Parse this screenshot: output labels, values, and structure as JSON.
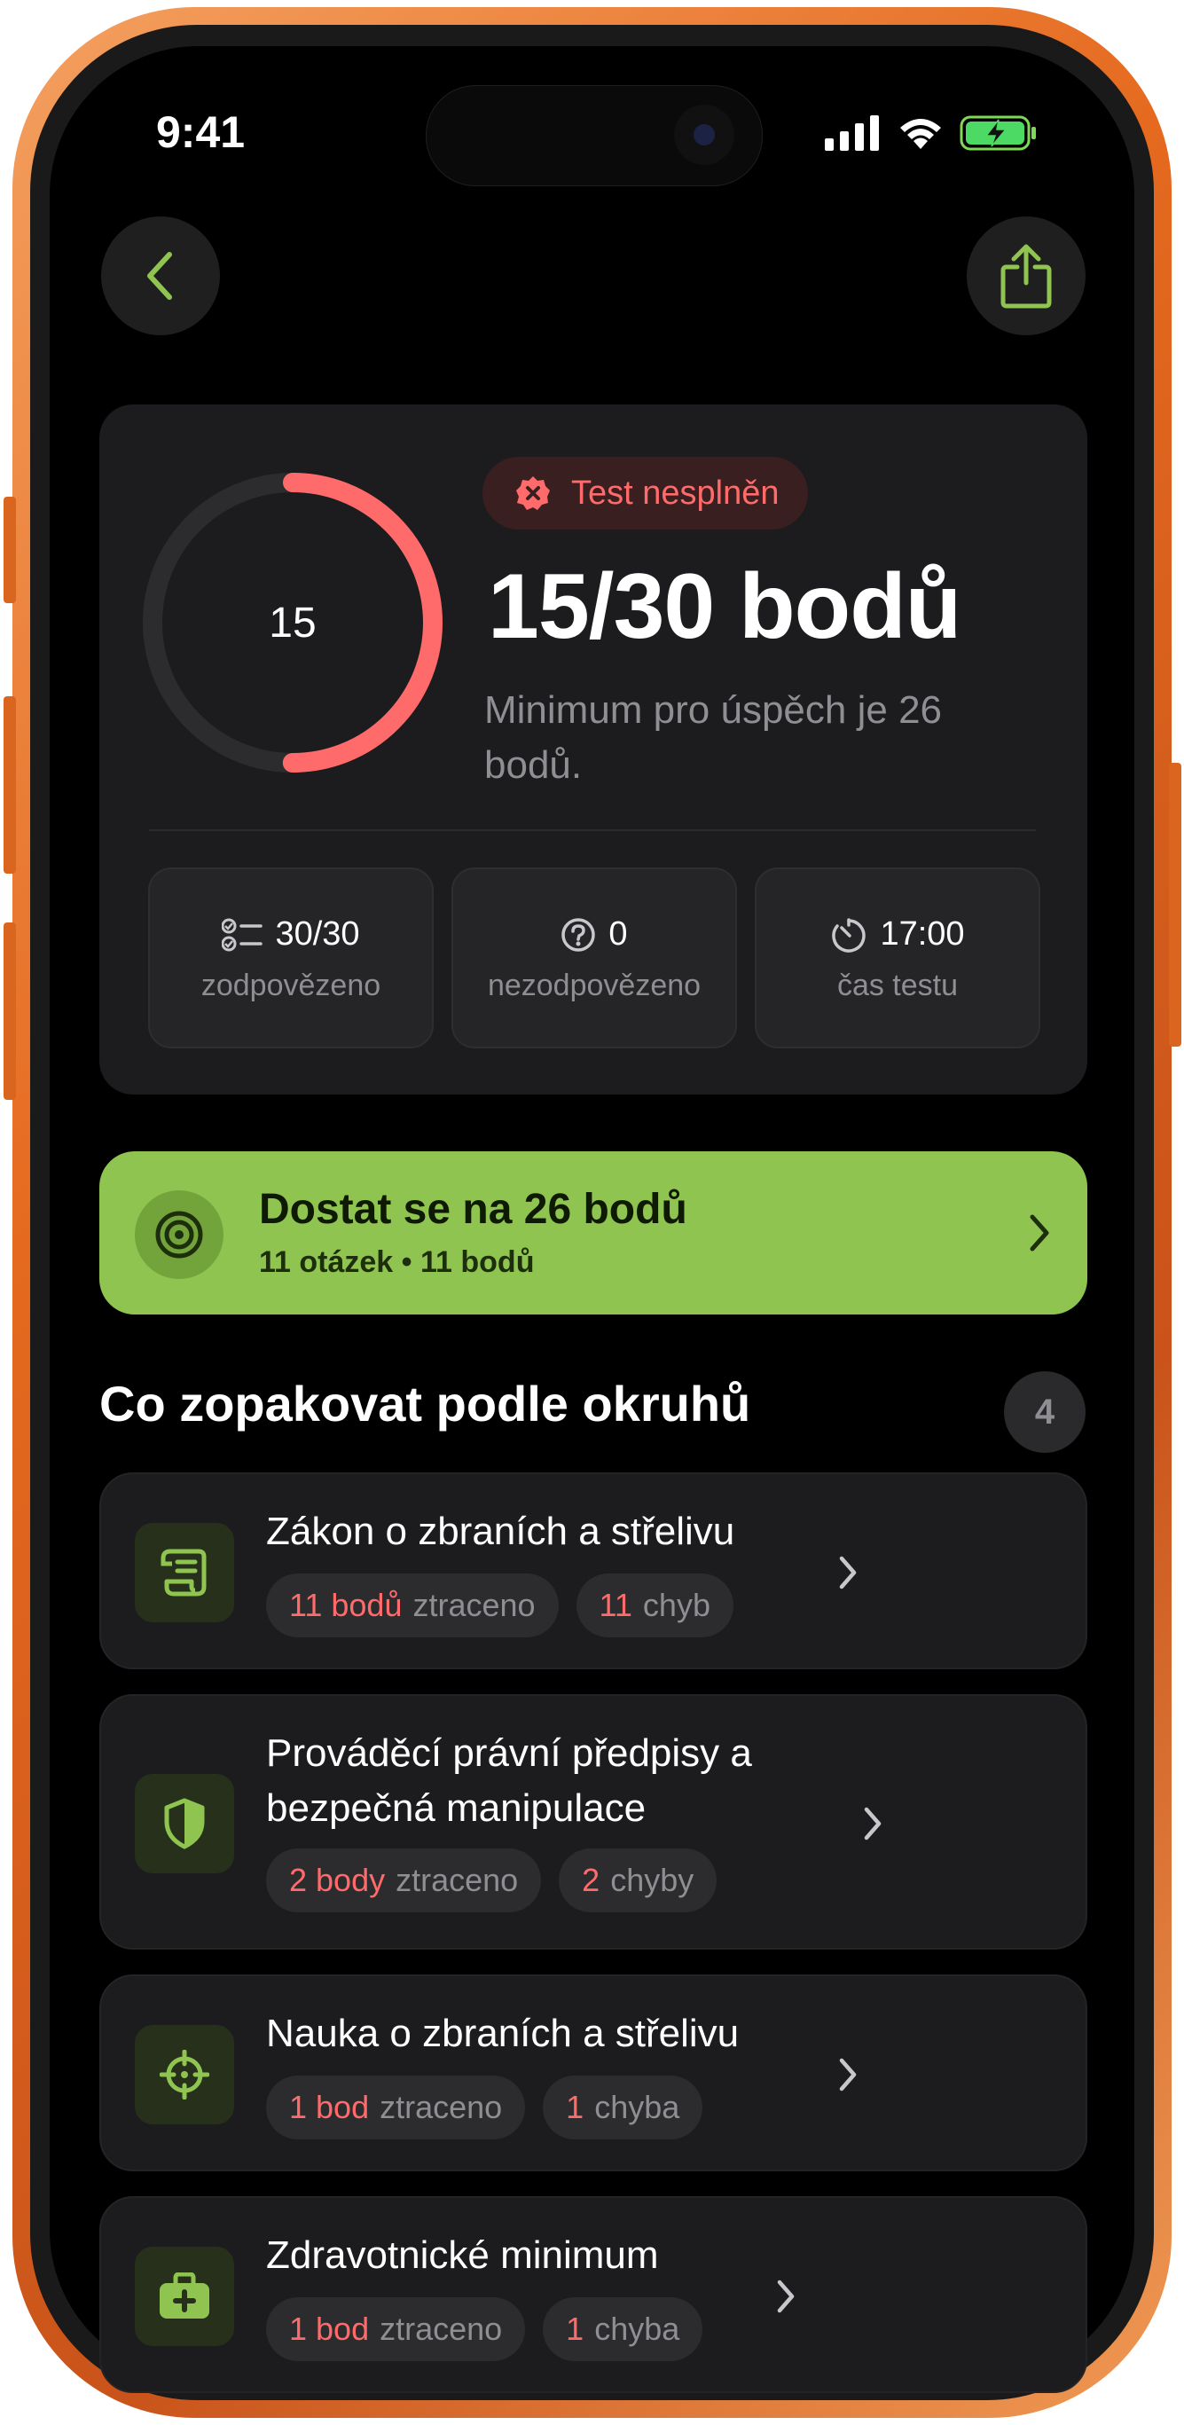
{
  "status_bar": {
    "time": "9:41"
  },
  "result": {
    "ring_value": "15",
    "ring_fraction": 0.5,
    "badge": "Test nesplněn",
    "score": "15/30 bodů",
    "minimum_text": "Minimum pro úspěch je 26 bodů."
  },
  "stats": [
    {
      "value": "30/30",
      "label": "zodpovězeno",
      "icon": "checklist-icon"
    },
    {
      "value": "0",
      "label": "nezodpovězeno",
      "icon": "question-circle-icon"
    },
    {
      "value": "17:00",
      "label": "čas testu",
      "icon": "timer-icon"
    }
  ],
  "goal": {
    "title": "Dostat se na 26 bodů",
    "subtitle": "11 otázek • 11 bodů",
    "icon": "target-icon"
  },
  "section": {
    "title": "Co zopakovat podle okruhů",
    "count": "4"
  },
  "topics": [
    {
      "title": "Zákon o zbraních a střelivu",
      "points": "11 bodů",
      "points_label": "ztraceno",
      "errors": "11",
      "errors_label": "chyb",
      "icon": "scroll-icon"
    },
    {
      "title": "Prováděcí právní předpisy a bezpečná manipulace",
      "points": "2 body",
      "points_label": "ztraceno",
      "errors": "2",
      "errors_label": "chyby",
      "icon": "shield-icon"
    },
    {
      "title": "Nauka o zbraních a střelivu",
      "points": "1 bod",
      "points_label": "ztraceno",
      "errors": "1",
      "errors_label": "chyba",
      "icon": "crosshair-icon"
    },
    {
      "title": "Zdravotnické minimum",
      "points": "1 bod",
      "points_label": "ztraceno",
      "errors": "1",
      "errors_label": "chyba",
      "icon": "first-aid-kit-icon"
    }
  ],
  "colors": {
    "accent_green": "#8fc451",
    "error_red": "#ff6b6b",
    "card_bg": "#1c1c1e"
  }
}
